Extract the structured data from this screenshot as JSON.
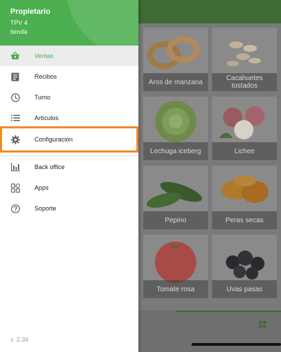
{
  "colors": {
    "brand": "#4caf50",
    "highlight": "#f08a24"
  },
  "drawer": {
    "owner": "Propietario",
    "pos": "TPV 4",
    "store": "tienda",
    "items": [
      {
        "label": "Ventas",
        "icon": "basket-icon",
        "active": true
      },
      {
        "label": "Recibos",
        "icon": "receipt-icon"
      },
      {
        "label": "Turno",
        "icon": "clock-icon"
      },
      {
        "label": "Artículos",
        "icon": "list-icon"
      },
      {
        "label": "Configuración",
        "icon": "gear-icon",
        "highlighted": true
      },
      {
        "label": "Back office",
        "icon": "bar-chart-icon"
      },
      {
        "label": "Apps",
        "icon": "apps-icon"
      },
      {
        "label": "Soporte",
        "icon": "help-icon"
      }
    ],
    "version": "v. 2.34"
  },
  "products": [
    {
      "name": "Aros de manzana"
    },
    {
      "name": "Cacahuetes tostados"
    },
    {
      "name": "Lechuga iceberg"
    },
    {
      "name": "Lichee"
    },
    {
      "name": "Pepino"
    },
    {
      "name": "Peras secas"
    },
    {
      "name": "Tomate rosa"
    },
    {
      "name": "Uvas pasas"
    }
  ]
}
